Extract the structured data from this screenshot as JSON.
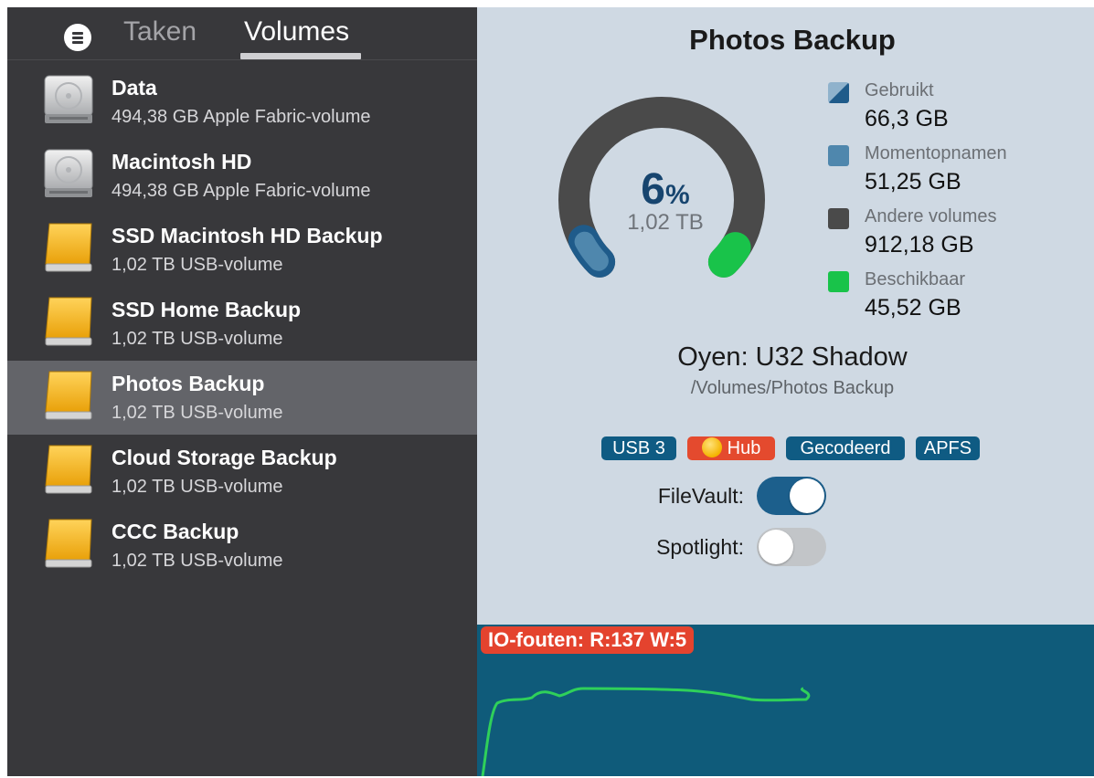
{
  "sidebar": {
    "tabs": [
      {
        "label": "Taken"
      },
      {
        "label": "Volumes"
      }
    ],
    "active_tab": "Volumes",
    "volumes": [
      {
        "name": "Data",
        "description": "494,38 GB Apple Fabric-volume",
        "icon": "internal-disk-icon"
      },
      {
        "name": "Macintosh HD",
        "description": "494,38 GB Apple Fabric-volume",
        "icon": "internal-disk-icon"
      },
      {
        "name": "SSD Macintosh HD Backup",
        "description": "1,02 TB USB-volume",
        "icon": "external-disk-icon"
      },
      {
        "name": "SSD Home Backup",
        "description": "1,02 TB USB-volume",
        "icon": "external-disk-icon"
      },
      {
        "name": "Photos Backup",
        "description": "1,02 TB USB-volume",
        "icon": "external-disk-icon",
        "selected": true
      },
      {
        "name": "Cloud Storage Backup",
        "description": "1,02 TB USB-volume",
        "icon": "external-disk-icon"
      },
      {
        "name": "CCC Backup",
        "description": "1,02 TB USB-volume",
        "icon": "external-disk-icon"
      }
    ]
  },
  "detail": {
    "title": "Photos Backup",
    "usage": {
      "percent": "6",
      "percent_sign": "%",
      "capacity": "1,02 TB",
      "fractions": {
        "gebruikt": 0.065,
        "momentopnamen": 0.05,
        "andere": 0.893,
        "beschikbaar": 0.045
      }
    },
    "legend": [
      {
        "label": "Gebruikt",
        "value": "66,3 GB",
        "color": "#1f5b8a"
      },
      {
        "label": "Momentopnamen",
        "value": "51,25 GB",
        "color": "#4f87ad"
      },
      {
        "label": "Andere volumes",
        "value": "912,18 GB",
        "color": "#4a4a4a"
      },
      {
        "label": "Beschikbaar",
        "value": "45,52 GB",
        "color": "#19c34a"
      }
    ],
    "device_name": "Oyen: U32 Shadow",
    "mount_path": "/Volumes/Photos Backup",
    "badges": {
      "usb": "USB 3",
      "hub": "Hub",
      "encrypted": "Gecodeerd",
      "filesystem": "APFS"
    },
    "toggles": {
      "filevault": {
        "label": "FileVault:",
        "on": true
      },
      "spotlight": {
        "label": "Spotlight:",
        "on": false
      }
    }
  },
  "io": {
    "label": "IO-fouten: R:137 W:5",
    "line_color": "#2fd05a"
  },
  "colors": {
    "sidebar_bg": "#38383b",
    "selected_row": "#636469",
    "detail_bg": "#cfd9e3",
    "io_bg": "#0f5b7a",
    "accent": "#0f5b83",
    "alert": "#e4432e"
  }
}
